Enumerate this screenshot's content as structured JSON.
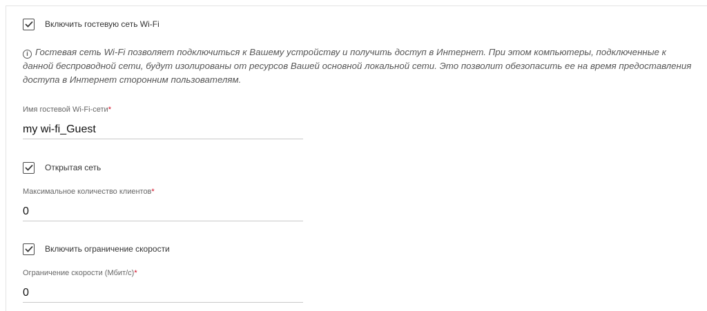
{
  "guest_wifi": {
    "enable_label": "Включить гостевую сеть Wi-Fi",
    "enabled": true
  },
  "info": {
    "icon": "info-icon",
    "text": "Гостевая сеть Wi-Fi позволяет подключиться к Вашему устройству и получить доступ в Интернет. При этом компьютеры, подключенные к данной беспроводной сети, будут изолированы от ресурсов Вашей основной локальной сети. Это позволит обезопасить ее на время предоставления доступа в Интернет сторонним пользователям."
  },
  "ssid": {
    "label": "Имя гостевой Wi-Fi-сети",
    "required_mark": "*",
    "value": "my wi-fi_Guest"
  },
  "open_network": {
    "label": "Открытая сеть",
    "checked": true
  },
  "max_clients": {
    "label": "Максимальное количество клиентов",
    "required_mark": "*",
    "value": "0"
  },
  "speed_limit_toggle": {
    "label": "Включить ограничение скорости",
    "checked": true
  },
  "speed_limit": {
    "label": "Ограничение скорости (Мбит/с)",
    "required_mark": "*",
    "value": "0"
  },
  "colors": {
    "required": "#d0021b",
    "checkbox_border": "#4a4a4a",
    "underline": "#c8c8c8"
  }
}
